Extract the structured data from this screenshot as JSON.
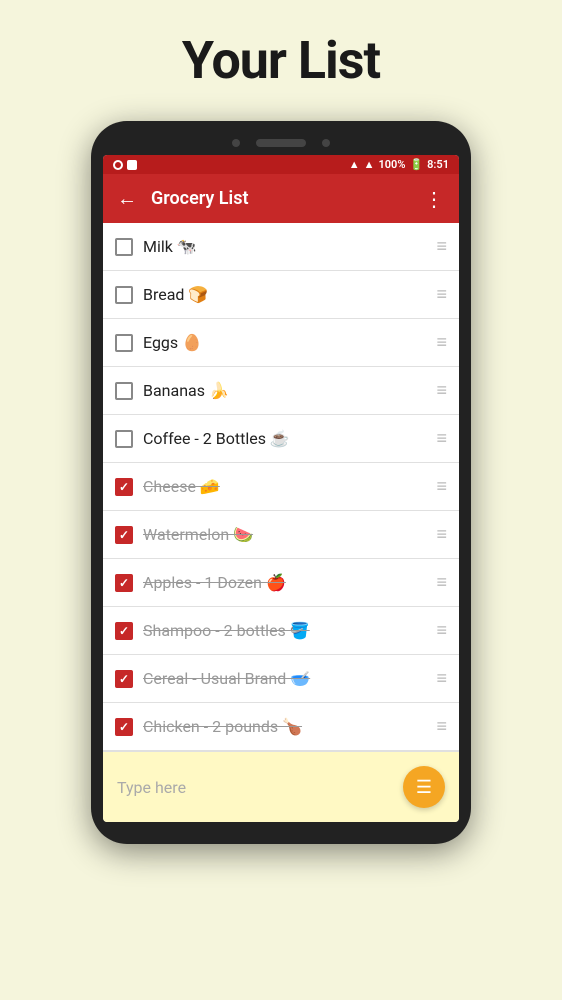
{
  "page": {
    "title": "Your List"
  },
  "appbar": {
    "back_label": "←",
    "title": "Grocery List",
    "more_label": "⋮"
  },
  "status_bar": {
    "time": "8:51",
    "battery": "100%"
  },
  "list_items": [
    {
      "id": 1,
      "text": "Milk 🐄",
      "checked": false
    },
    {
      "id": 2,
      "text": "Bread 🍞",
      "checked": false
    },
    {
      "id": 3,
      "text": "Eggs 🥚",
      "checked": false
    },
    {
      "id": 4,
      "text": "Bananas 🍌",
      "checked": false
    },
    {
      "id": 5,
      "text": "Coffee - 2 Bottles ☕",
      "checked": false
    },
    {
      "id": 6,
      "text": "Cheese 🧀",
      "checked": true
    },
    {
      "id": 7,
      "text": "Watermelon 🍉",
      "checked": true
    },
    {
      "id": 8,
      "text": "Apples - 1 Dozen 🍎",
      "checked": true
    },
    {
      "id": 9,
      "text": "Shampoo - 2 bottles 🪣",
      "checked": true
    },
    {
      "id": 10,
      "text": "Cereal - Usual Brand 🥣",
      "checked": true
    },
    {
      "id": 11,
      "text": "Chicken - 2 pounds 🍗",
      "checked": true
    }
  ],
  "input": {
    "placeholder": "Type here"
  },
  "drag_handle": "≡",
  "add_button_label": "≡"
}
